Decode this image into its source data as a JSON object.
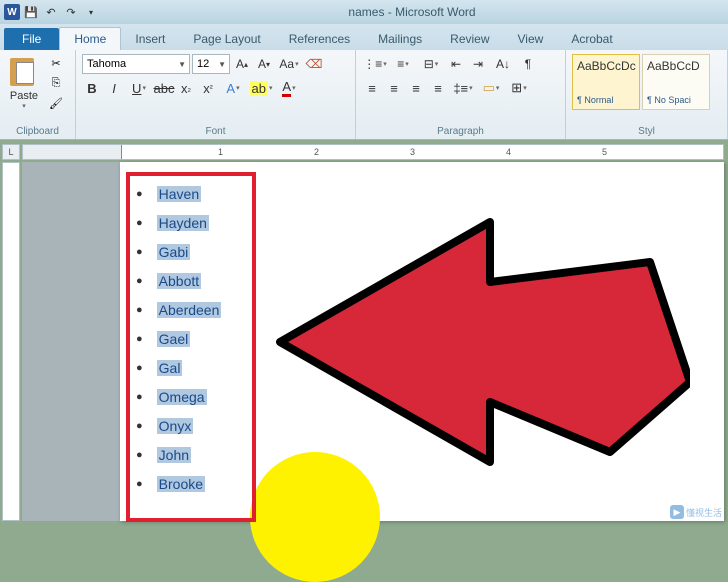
{
  "titlebar": {
    "title": "names - Microsoft Word"
  },
  "tabs": {
    "file": "File",
    "items": [
      "Home",
      "Insert",
      "Page Layout",
      "References",
      "Mailings",
      "Review",
      "View",
      "Acrobat"
    ],
    "active_index": 0
  },
  "ribbon": {
    "clipboard": {
      "paste": "Paste",
      "label": "Clipboard"
    },
    "font": {
      "label": "Font",
      "name": "Tahoma",
      "size": "12"
    },
    "paragraph": {
      "label": "Paragraph"
    },
    "styles": {
      "label": "Styl",
      "items": [
        {
          "preview": "AaBbCcDc",
          "name": "¶ Normal"
        },
        {
          "preview": "AaBbCcD",
          "name": "¶ No Spaci"
        }
      ]
    }
  },
  "ruler": {
    "corner": "L",
    "marks": [
      "1",
      "2",
      "3",
      "4",
      "5"
    ]
  },
  "document": {
    "names": [
      "Haven",
      "Hayden",
      "Gabi",
      "Abbott",
      "Aberdeen",
      "Gael",
      "Gal",
      "Omega",
      "Onyx",
      "John",
      "Brooke"
    ]
  },
  "watermark": "懂视生活"
}
